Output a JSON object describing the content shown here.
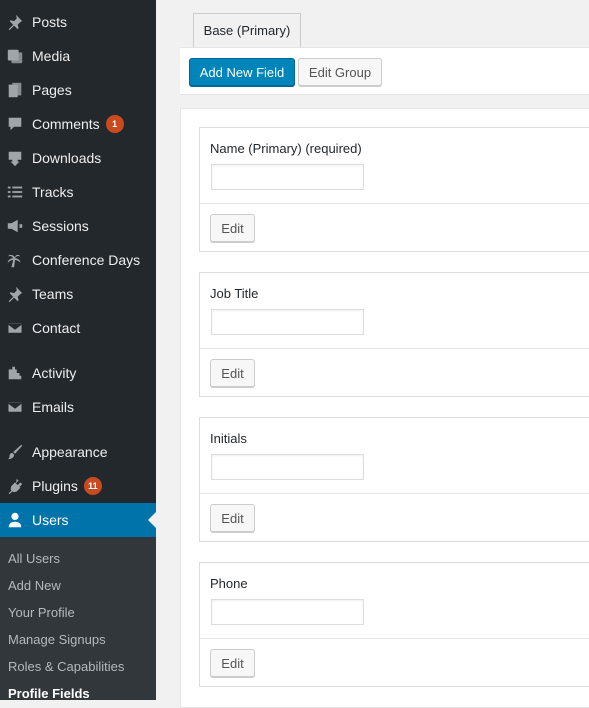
{
  "sidebar": {
    "items": [
      {
        "label": "Posts",
        "icon": "pin-icon"
      },
      {
        "label": "Media",
        "icon": "media-icon"
      },
      {
        "label": "Pages",
        "icon": "pages-icon"
      },
      {
        "label": "Comments",
        "icon": "comment-icon",
        "badge": "1"
      },
      {
        "label": "Downloads",
        "icon": "download-icon"
      },
      {
        "label": "Tracks",
        "icon": "list-icon"
      },
      {
        "label": "Sessions",
        "icon": "megaphone-icon"
      },
      {
        "label": "Conference Days",
        "icon": "palm-tree-icon"
      },
      {
        "label": "Teams",
        "icon": "pin-icon"
      },
      {
        "label": "Contact",
        "icon": "envelope-icon"
      },
      {
        "label": "Activity",
        "icon": "activity-icon"
      },
      {
        "label": "Emails",
        "icon": "envelope-icon"
      },
      {
        "label": "Appearance",
        "icon": "brush-icon"
      },
      {
        "label": "Plugins",
        "icon": "plug-icon",
        "badge": "11"
      },
      {
        "label": "Users",
        "icon": "user-icon"
      }
    ],
    "submenu": [
      "All Users",
      "Add New",
      "Your Profile",
      "Manage Signups",
      "Roles & Capabilities",
      "Profile Fields"
    ]
  },
  "main": {
    "tab_label": "Base (Primary)",
    "add_field_label": "Add New Field",
    "edit_group_label": "Edit Group",
    "fields": [
      {
        "label": "Name (Primary) (required)",
        "edit": "Edit"
      },
      {
        "label": "Job Title",
        "edit": "Edit"
      },
      {
        "label": "Initials",
        "edit": "Edit"
      },
      {
        "label": "Phone",
        "edit": "Edit"
      }
    ]
  },
  "colors": {
    "sidebar_bg": "#23282d",
    "submenu_bg": "#32373c",
    "accent": "#0073aa",
    "primary_button": "#0085ba",
    "badge": "#ca4a1f"
  }
}
